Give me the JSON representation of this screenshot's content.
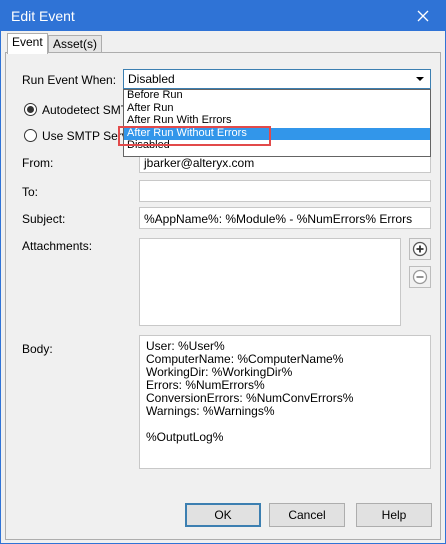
{
  "window": {
    "title": "Edit Event"
  },
  "tabs": [
    {
      "label": "Event"
    },
    {
      "label": "Asset(s)"
    }
  ],
  "run_event": {
    "label": "Run Event When:",
    "selected": "Disabled",
    "options": [
      "Before Run",
      "After Run",
      "After Run With Errors",
      "After Run Without Errors",
      "Disabled"
    ],
    "highlighted": "After Run Without Errors"
  },
  "smtp": {
    "autodetect_label": "Autodetect SMTP",
    "use_server_label": "Use SMTP Server"
  },
  "from": {
    "label": "From:",
    "value": "jbarker@alteryx.com"
  },
  "to": {
    "label": "To:",
    "value": ""
  },
  "subject": {
    "label": "Subject:",
    "value": "%AppName%: %Module% - %NumErrors% Errors"
  },
  "attachments": {
    "label": "Attachments:"
  },
  "body": {
    "label": "Body:",
    "lines": [
      "User: %User%",
      "ComputerName: %ComputerName%",
      "WorkingDir: %WorkingDir%",
      "Errors: %NumErrors%",
      "ConversionErrors: %NumConvErrors%",
      "Warnings: %Warnings%",
      "",
      "%OutputLog%"
    ]
  },
  "buttons": {
    "ok": "OK",
    "cancel": "Cancel",
    "help": "Help"
  },
  "colors": {
    "titlebar": "#2f73d6",
    "selection": "#3296ea",
    "highlight_border": "#e24a4a"
  }
}
